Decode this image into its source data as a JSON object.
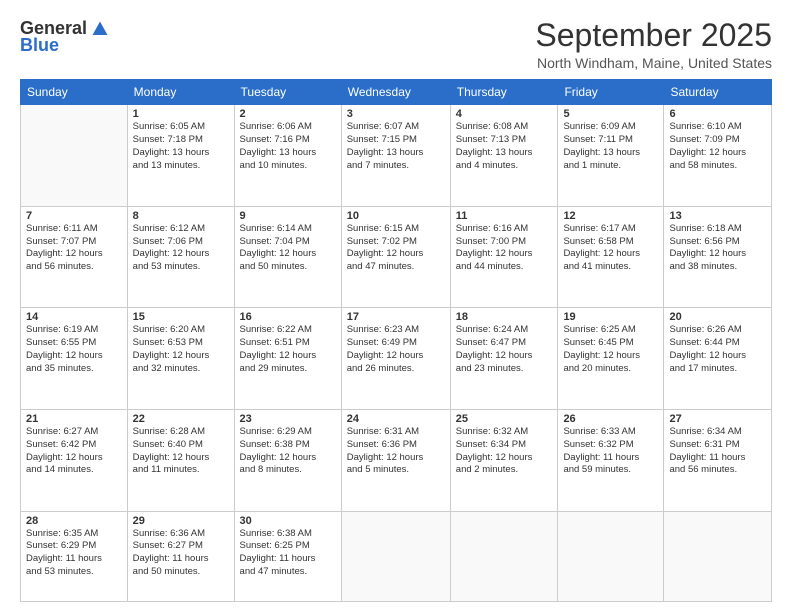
{
  "logo": {
    "general": "General",
    "blue": "Blue"
  },
  "title": "September 2025",
  "subtitle": "North Windham, Maine, United States",
  "days_of_week": [
    "Sunday",
    "Monday",
    "Tuesday",
    "Wednesday",
    "Thursday",
    "Friday",
    "Saturday"
  ],
  "weeks": [
    [
      {
        "day": "",
        "info": ""
      },
      {
        "day": "1",
        "info": "Sunrise: 6:05 AM\nSunset: 7:18 PM\nDaylight: 13 hours\nand 13 minutes."
      },
      {
        "day": "2",
        "info": "Sunrise: 6:06 AM\nSunset: 7:16 PM\nDaylight: 13 hours\nand 10 minutes."
      },
      {
        "day": "3",
        "info": "Sunrise: 6:07 AM\nSunset: 7:15 PM\nDaylight: 13 hours\nand 7 minutes."
      },
      {
        "day": "4",
        "info": "Sunrise: 6:08 AM\nSunset: 7:13 PM\nDaylight: 13 hours\nand 4 minutes."
      },
      {
        "day": "5",
        "info": "Sunrise: 6:09 AM\nSunset: 7:11 PM\nDaylight: 13 hours\nand 1 minute."
      },
      {
        "day": "6",
        "info": "Sunrise: 6:10 AM\nSunset: 7:09 PM\nDaylight: 12 hours\nand 58 minutes."
      }
    ],
    [
      {
        "day": "7",
        "info": "Sunrise: 6:11 AM\nSunset: 7:07 PM\nDaylight: 12 hours\nand 56 minutes."
      },
      {
        "day": "8",
        "info": "Sunrise: 6:12 AM\nSunset: 7:06 PM\nDaylight: 12 hours\nand 53 minutes."
      },
      {
        "day": "9",
        "info": "Sunrise: 6:14 AM\nSunset: 7:04 PM\nDaylight: 12 hours\nand 50 minutes."
      },
      {
        "day": "10",
        "info": "Sunrise: 6:15 AM\nSunset: 7:02 PM\nDaylight: 12 hours\nand 47 minutes."
      },
      {
        "day": "11",
        "info": "Sunrise: 6:16 AM\nSunset: 7:00 PM\nDaylight: 12 hours\nand 44 minutes."
      },
      {
        "day": "12",
        "info": "Sunrise: 6:17 AM\nSunset: 6:58 PM\nDaylight: 12 hours\nand 41 minutes."
      },
      {
        "day": "13",
        "info": "Sunrise: 6:18 AM\nSunset: 6:56 PM\nDaylight: 12 hours\nand 38 minutes."
      }
    ],
    [
      {
        "day": "14",
        "info": "Sunrise: 6:19 AM\nSunset: 6:55 PM\nDaylight: 12 hours\nand 35 minutes."
      },
      {
        "day": "15",
        "info": "Sunrise: 6:20 AM\nSunset: 6:53 PM\nDaylight: 12 hours\nand 32 minutes."
      },
      {
        "day": "16",
        "info": "Sunrise: 6:22 AM\nSunset: 6:51 PM\nDaylight: 12 hours\nand 29 minutes."
      },
      {
        "day": "17",
        "info": "Sunrise: 6:23 AM\nSunset: 6:49 PM\nDaylight: 12 hours\nand 26 minutes."
      },
      {
        "day": "18",
        "info": "Sunrise: 6:24 AM\nSunset: 6:47 PM\nDaylight: 12 hours\nand 23 minutes."
      },
      {
        "day": "19",
        "info": "Sunrise: 6:25 AM\nSunset: 6:45 PM\nDaylight: 12 hours\nand 20 minutes."
      },
      {
        "day": "20",
        "info": "Sunrise: 6:26 AM\nSunset: 6:44 PM\nDaylight: 12 hours\nand 17 minutes."
      }
    ],
    [
      {
        "day": "21",
        "info": "Sunrise: 6:27 AM\nSunset: 6:42 PM\nDaylight: 12 hours\nand 14 minutes."
      },
      {
        "day": "22",
        "info": "Sunrise: 6:28 AM\nSunset: 6:40 PM\nDaylight: 12 hours\nand 11 minutes."
      },
      {
        "day": "23",
        "info": "Sunrise: 6:29 AM\nSunset: 6:38 PM\nDaylight: 12 hours\nand 8 minutes."
      },
      {
        "day": "24",
        "info": "Sunrise: 6:31 AM\nSunset: 6:36 PM\nDaylight: 12 hours\nand 5 minutes."
      },
      {
        "day": "25",
        "info": "Sunrise: 6:32 AM\nSunset: 6:34 PM\nDaylight: 12 hours\nand 2 minutes."
      },
      {
        "day": "26",
        "info": "Sunrise: 6:33 AM\nSunset: 6:32 PM\nDaylight: 11 hours\nand 59 minutes."
      },
      {
        "day": "27",
        "info": "Sunrise: 6:34 AM\nSunset: 6:31 PM\nDaylight: 11 hours\nand 56 minutes."
      }
    ],
    [
      {
        "day": "28",
        "info": "Sunrise: 6:35 AM\nSunset: 6:29 PM\nDaylight: 11 hours\nand 53 minutes."
      },
      {
        "day": "29",
        "info": "Sunrise: 6:36 AM\nSunset: 6:27 PM\nDaylight: 11 hours\nand 50 minutes."
      },
      {
        "day": "30",
        "info": "Sunrise: 6:38 AM\nSunset: 6:25 PM\nDaylight: 11 hours\nand 47 minutes."
      },
      {
        "day": "",
        "info": ""
      },
      {
        "day": "",
        "info": ""
      },
      {
        "day": "",
        "info": ""
      },
      {
        "day": "",
        "info": ""
      }
    ]
  ]
}
